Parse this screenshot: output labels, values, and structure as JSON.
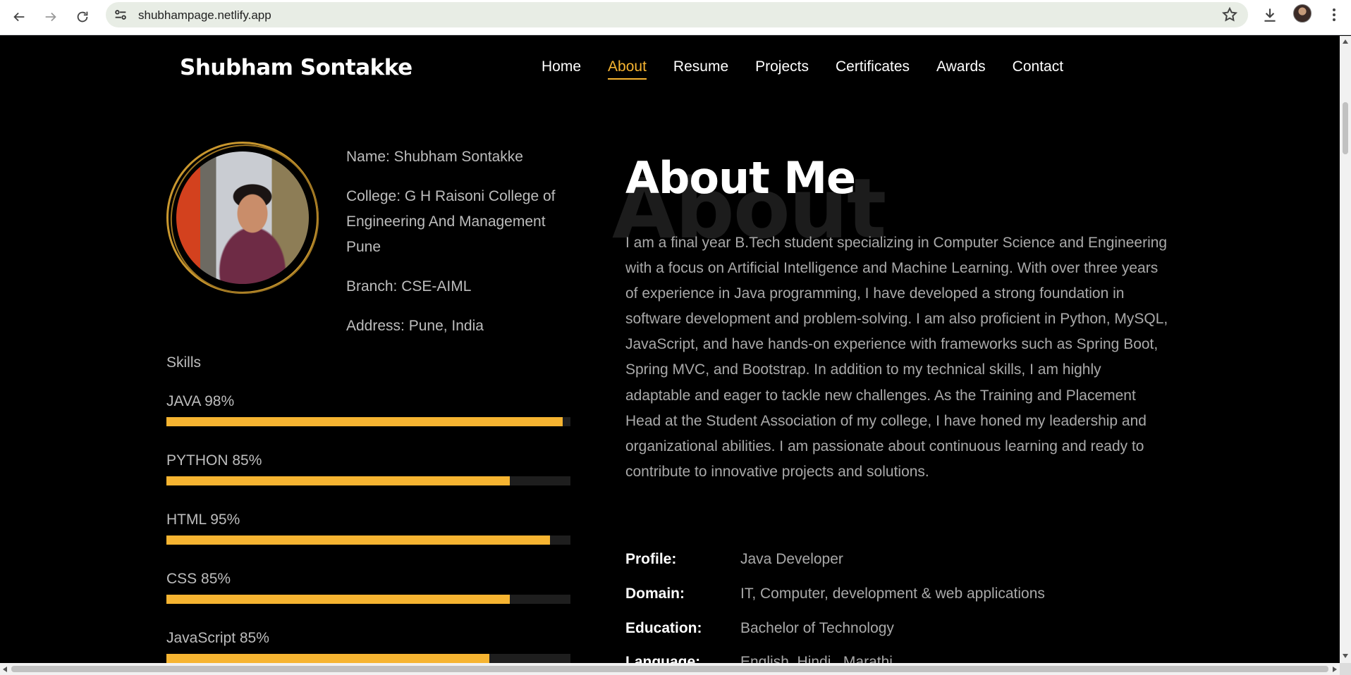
{
  "browser": {
    "url": "shubhampage.netlify.app"
  },
  "site": {
    "logo": "Shubham Sontakke",
    "nav": [
      "Home",
      "About",
      "Resume",
      "Projects",
      "Certificates",
      "Awards",
      "Contact"
    ],
    "active_nav": "About"
  },
  "info": [
    "Name: Shubham Sontakke",
    "College: G H Raisoni College of Engineering And Management Pune",
    "Branch: CSE-AIML",
    "Address: Pune, India"
  ],
  "skills": {
    "title": "Skills",
    "items": [
      {
        "label": "JAVA 98%",
        "percent": 98
      },
      {
        "label": "PYTHON 85%",
        "percent": 85
      },
      {
        "label": "HTML 95%",
        "percent": 95
      },
      {
        "label": "CSS 85%",
        "percent": 85
      },
      {
        "label": "JavaScript 85%",
        "percent": 80
      }
    ]
  },
  "about": {
    "bg_word": "About",
    "title": "About Me",
    "text": "I am a final year B.Tech student specializing in Computer Science and Engineering with a focus on Artificial Intelligence and Machine Learning. With over three years of experience in Java programming, I have developed a strong foundation in software development and problem-solving. I am also proficient in Python, MySQL, JavaScript, and have hands-on experience with frameworks such as Spring Boot, Spring MVC, and Bootstrap. In addition to my technical skills, I am highly adaptable and eager to tackle new challenges. As the Training and Placement Head at the Student Association of my college, I have honed my leadership and organizational abilities. I am passionate about continuous learning and ready to contribute to innovative projects and solutions.",
    "details": [
      {
        "key": "Profile:",
        "value": "Java Developer"
      },
      {
        "key": "Domain:",
        "value": "IT, Computer, development & web applications"
      },
      {
        "key": "Education:",
        "value": "Bachelor of Technology"
      },
      {
        "key": "Language:",
        "value": "English, Hindi , Marathi"
      }
    ]
  },
  "colors": {
    "accent": "#f6b431",
    "background": "#000000"
  }
}
